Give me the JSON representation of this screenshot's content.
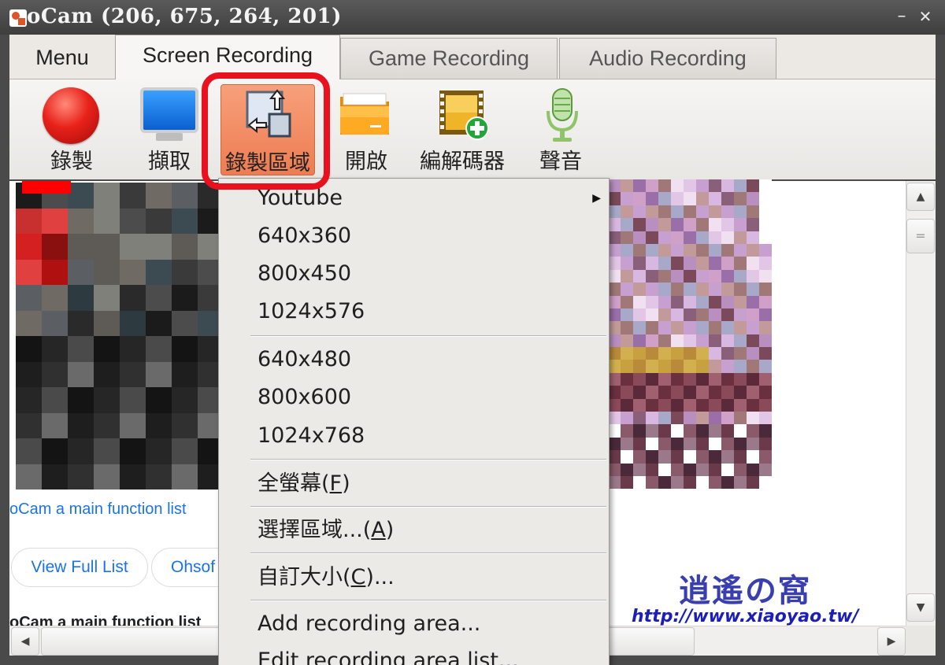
{
  "window": {
    "title": "oCam (206, 675, 264, 201)"
  },
  "titlebar": {
    "minimize": "–",
    "close": "✕"
  },
  "tabs": [
    {
      "label": "Menu"
    },
    {
      "label": "Screen Recording"
    },
    {
      "label": "Game Recording"
    },
    {
      "label": "Audio Recording"
    }
  ],
  "toolbar": {
    "record": "錄製",
    "capture": "擷取",
    "area": "錄製區域",
    "open": "開啟",
    "codec": "編解碼器",
    "sound": "聲音"
  },
  "icons": {
    "record": "record-icon",
    "capture": "monitor-icon",
    "area": "resize-area-icon",
    "open": "folder-icon",
    "codec": "film-add-icon",
    "sound": "microphone-icon"
  },
  "colors": {
    "highlight": "#e8111d",
    "area_button": "#ee7c52",
    "link": "#1a73e8",
    "watermark": "#1b1fb8"
  },
  "menu": {
    "youtube": "Youtube",
    "items_group1": [
      "640x360",
      "800x450",
      "1024x576"
    ],
    "items_group2": [
      "640x480",
      "800x600",
      "1024x768"
    ],
    "fullscreen": {
      "label": "全螢幕(",
      "key": "F",
      "suffix": ")"
    },
    "select_area": {
      "label": "選擇區域...(",
      "key": "A",
      "suffix": ")"
    },
    "custom_size": {
      "label": "自訂大小(",
      "key": "C",
      "suffix": ")..."
    },
    "add_area": "Add recording area...",
    "edit_area": "Edit recording area list..."
  },
  "content": {
    "link": "oCam a main function list",
    "pill_view": "View Full List",
    "pill_ohsoft": "Ohsof",
    "cut_text": "oCam a main function list"
  },
  "scroll": {
    "up": "▲",
    "down": "▼",
    "left": "◀",
    "right": "▶",
    "grip": "="
  },
  "watermark": {
    "title": "逍遙の窩",
    "url": "http://www.xiaoyao.tw/"
  }
}
